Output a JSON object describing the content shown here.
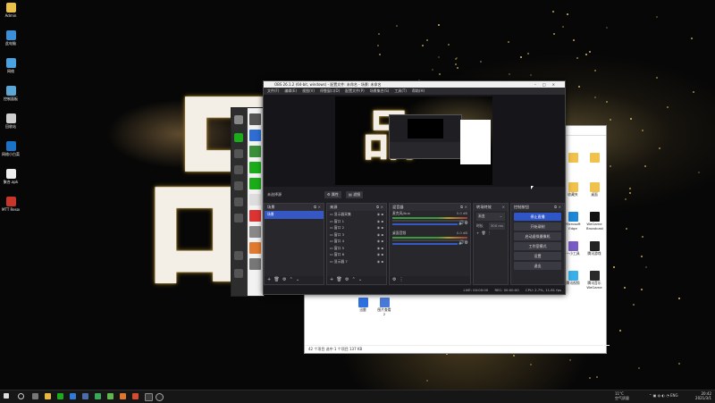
{
  "desktop": {
    "icons": [
      {
        "label": "Admin",
        "color": "#e8c04a"
      },
      {
        "label": "此电脑",
        "color": "#3a8fd8"
      },
      {
        "label": "网络",
        "color": "#4aa3e0"
      },
      {
        "label": "控制面板",
        "color": "#5ca6d6"
      },
      {
        "label": "回收站",
        "color": "#cfcfcf"
      },
      {
        "label": "网络小白菜体系",
        "color": "#1a73c9"
      },
      {
        "label": "聚合.apk",
        "color": "#eeeeee"
      },
      {
        "label": "MTT Resourc...",
        "color": "#c7352b"
      }
    ],
    "wallpaper_glyph": "品"
  },
  "explorer": {
    "status_text": "42 个项目    选中 1 个项目  137 KB",
    "right_icons": [
      {
        "label": "",
        "color": "#f0c24b"
      },
      {
        "label": "",
        "color": "#f0c24b"
      },
      {
        "label": "收藏夹",
        "color": "#f0c24b"
      },
      {
        "label": "桌面",
        "color": "#f0c24b"
      },
      {
        "label": "Microsoft Edge",
        "color": "#1e88d6"
      },
      {
        "label": "WeGame Broadcast",
        "color": "#111111"
      },
      {
        "label": "一小工具",
        "color": "#7a5cc4"
      },
      {
        "label": "腾讯游戏",
        "color": "#222222"
      },
      {
        "label": "腾讯视频",
        "color": "#3ab0ea"
      },
      {
        "label": "腾讯音乐 WeGame",
        "color": "#2a2a2a"
      }
    ],
    "bottom_icons": [
      {
        "label": "迅雷",
        "color": "#2f6fe0"
      },
      {
        "label": "图片查看 2",
        "color": "#4a7ad8"
      }
    ]
  },
  "obs": {
    "title": "OBS 26.1.2 (64-bit, windows) - 配置文件: 未命名 - 场景: 未命名",
    "menu": [
      "文件(F)",
      "编辑(E)",
      "视图(V)",
      "停靠窗口(D)",
      "配置文件(P)",
      "场景集合(S)",
      "工具(T)",
      "帮助(H)"
    ],
    "source_toolbar": {
      "name": "未选择源",
      "properties": "属性",
      "filters": "滤镜"
    },
    "docks": {
      "scenes": {
        "title": "场景",
        "items": [
          "场景"
        ]
      },
      "sources": {
        "title": "来源",
        "items": [
          "显示器采集",
          "窗口 1",
          "窗口 2",
          "窗口 3",
          "窗口 4",
          "窗口 5",
          "窗口 6",
          "显示器 7"
        ]
      },
      "mixer": {
        "title": "混音器",
        "channels": [
          {
            "name": "麦克风/Aux",
            "db": "0.0 dB"
          },
          {
            "name": "桌面音频",
            "db": "0.0 dB"
          }
        ]
      },
      "transitions": {
        "title": "转场特效",
        "type": "渐变",
        "duration_label": "时长",
        "duration_value": "300 ms"
      },
      "controls": {
        "title": "控制按钮",
        "buttons": [
          "停止直播",
          "开始录制",
          "启动虚拟摄像机",
          "工作室模式",
          "设置",
          "退出"
        ]
      }
    },
    "status": {
      "live": "LIVE: 00:00:00",
      "rec": "REC: 00:00:00",
      "cpu": "CPU: 2.7%, 11.81 fps"
    }
  },
  "taskbar": {
    "tray_weather_temp": "11°C",
    "tray_weather_text": "空气质量",
    "tray_lang": "ENG",
    "clock_time": "20:42",
    "clock_date": "2021/3/1"
  },
  "colors": {
    "obs_accent": "#3658c5",
    "obs_bg": "#1f1f23",
    "wallpaper_gold": "#c9a14a"
  }
}
